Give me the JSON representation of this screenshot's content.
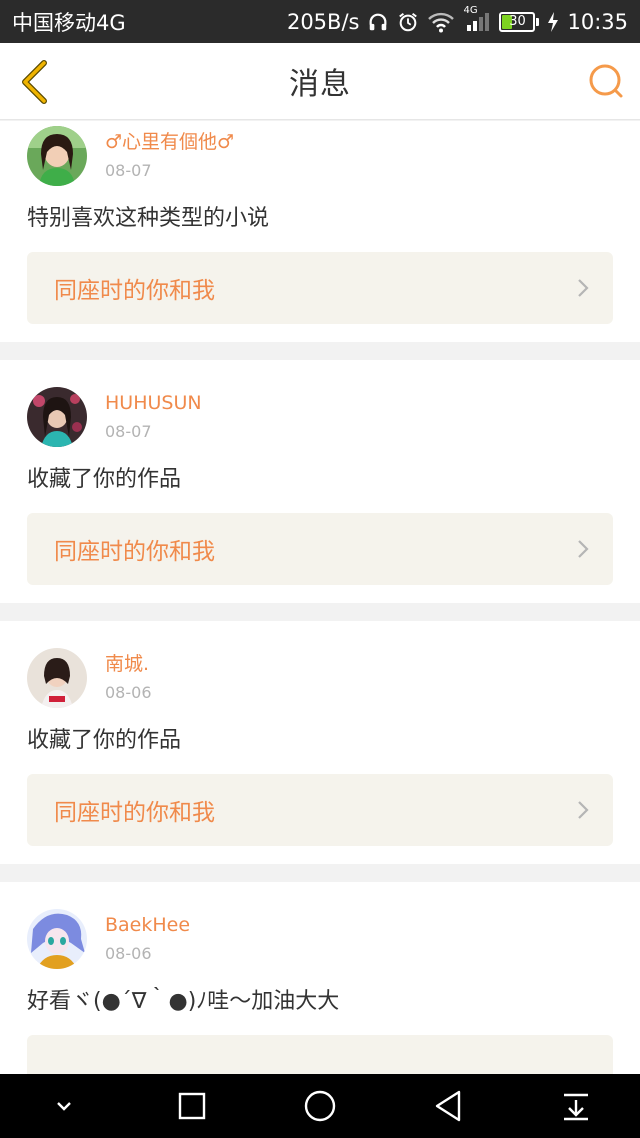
{
  "status_bar": {
    "carrier": "中国移动4G",
    "net_speed": "205B/s",
    "signal_label": "4G",
    "battery": "30",
    "time": "10:35"
  },
  "header": {
    "title": "消息"
  },
  "colors": {
    "accent": "#f08a4b",
    "back_icon": "#f0b400",
    "search_icon": "#f59a4a",
    "link_bg": "#f5f3ec",
    "page_bg": "#f2f2f2"
  },
  "messages": [
    {
      "username": "♂心里有個他♂",
      "date": "08-07",
      "text": "特别喜欢这种类型的小说",
      "work_title": "同座时的你和我",
      "avatar_icon": "avatar-girl-green"
    },
    {
      "username": "HUHUSUN",
      "date": "08-07",
      "text": "收藏了你的作品",
      "work_title": "同座时的你和我",
      "avatar_icon": "avatar-girl-dark"
    },
    {
      "username": "南城.",
      "date": "08-06",
      "text": "收藏了你的作品",
      "work_title": "同座时的你和我",
      "avatar_icon": "avatar-child"
    },
    {
      "username": "BaekHee",
      "date": "08-06",
      "text": "好看ヾ(●´∇｀●)ﾉ哇～加油大大",
      "work_title": "",
      "avatar_icon": "avatar-anime"
    }
  ],
  "nav": [
    "collapse-icon",
    "recent-apps-icon",
    "home-icon",
    "back-icon",
    "notification-pulldown-icon"
  ]
}
